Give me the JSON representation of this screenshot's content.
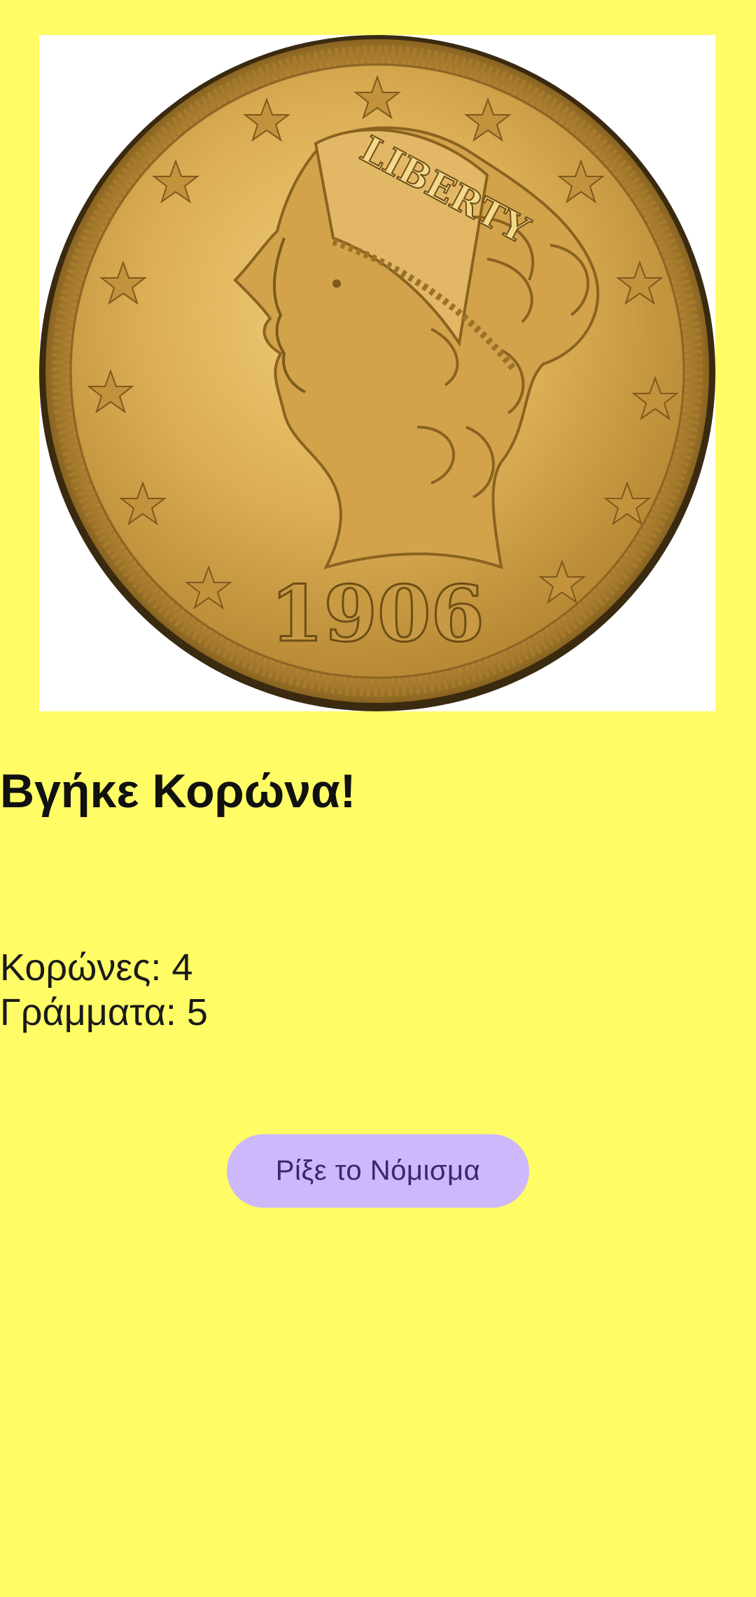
{
  "coin": {
    "image_icon": "gold-liberty-coin-heads",
    "inscription": "LIBERTY",
    "year": "1906"
  },
  "result": {
    "title": "Βγήκε Κορώνα!"
  },
  "counters": {
    "heads": "Κορώνες: 4",
    "tails": "Γράμματα: 5"
  },
  "actions": {
    "flip_label": "Ρίξε το Νόμισμα"
  },
  "colors": {
    "background": "#fffc66",
    "button": "#cdb8fb",
    "button_text": "#3a2670",
    "coin_gold": "#d4a646"
  }
}
